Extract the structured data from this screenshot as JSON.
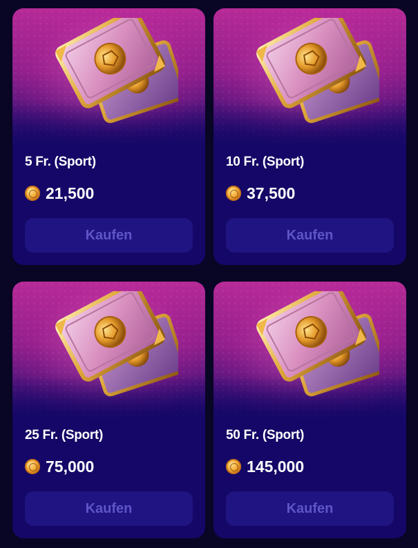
{
  "button_label": "Kaufen",
  "products": [
    {
      "title": "5 Fr. (Sport)",
      "price": "21,500"
    },
    {
      "title": "10 Fr. (Sport)",
      "price": "37,500"
    },
    {
      "title": "25 Fr. (Sport)",
      "price": "75,000"
    },
    {
      "title": "50 Fr. (Sport)",
      "price": "145,000"
    }
  ],
  "icons": {
    "hero": "banknotes-with-gold-soccer-coins",
    "currency": "gold-coin-icon"
  },
  "colors": {
    "background": "#080525",
    "card": "#140767",
    "button": "#1f1481",
    "button_text": "#5f55c8",
    "hero_top": "#b62a97"
  }
}
